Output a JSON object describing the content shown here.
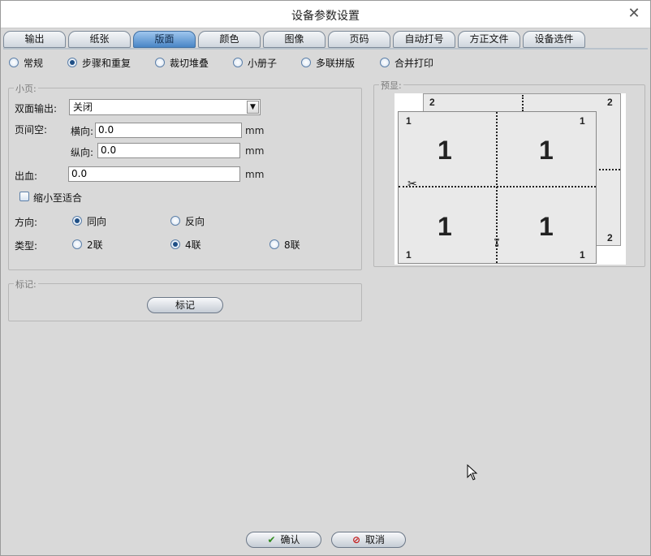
{
  "window": {
    "title": "设备参数设置",
    "close_label": "✕"
  },
  "tabs": [
    {
      "label": "输出"
    },
    {
      "label": "纸张"
    },
    {
      "label": "版面"
    },
    {
      "label": "颜色"
    },
    {
      "label": "图像"
    },
    {
      "label": "页码"
    },
    {
      "label": "自动打号"
    },
    {
      "label": "方正文件"
    },
    {
      "label": "设备选件"
    }
  ],
  "active_tab": "版面",
  "layout_modes": [
    {
      "label": "常规",
      "selected": false
    },
    {
      "label": "步骤和重复",
      "selected": true
    },
    {
      "label": "裁切堆叠",
      "selected": false
    },
    {
      "label": "小册子",
      "selected": false
    },
    {
      "label": "多联拼版",
      "selected": false
    },
    {
      "label": "合并打印",
      "selected": false
    }
  ],
  "small_page": {
    "title": "小页:",
    "duplex_label": "双面输出:",
    "duplex_value": "关闭",
    "gap_label": "页间空:",
    "horizontal_label": "横向:",
    "horizontal_value": "0.0",
    "vertical_label": "纵向:",
    "vertical_value": "0.0",
    "bleed_label": "出血:",
    "bleed_value": "0.0",
    "unit": "mm",
    "shrink_label": "缩小至适合",
    "shrink_checked": false,
    "direction_label": "方向:",
    "direction_options": [
      {
        "label": "同向",
        "selected": true
      },
      {
        "label": "反向",
        "selected": false
      }
    ],
    "type_label": "类型:",
    "type_options": [
      {
        "label": "2联",
        "selected": false
      },
      {
        "label": "4联",
        "selected": true
      },
      {
        "label": "8联",
        "selected": false
      }
    ]
  },
  "marks": {
    "title": "标记:",
    "button_label": "标记"
  },
  "preview": {
    "title": "预显:",
    "front_page_number": "1",
    "back_page_number": "2",
    "big_numbers": [
      "1",
      "1",
      "1",
      "1"
    ]
  },
  "footer": {
    "ok_label": "确认",
    "cancel_label": "取消"
  },
  "colors": {
    "active_tab": "#4a86c6",
    "background": "#d9d9d9"
  },
  "icons": {
    "close": "close-icon",
    "ok": "checkmark-icon",
    "cancel": "no-entry-icon",
    "scissors": "scissors-icon",
    "cursor": "mouse-cursor-icon"
  }
}
